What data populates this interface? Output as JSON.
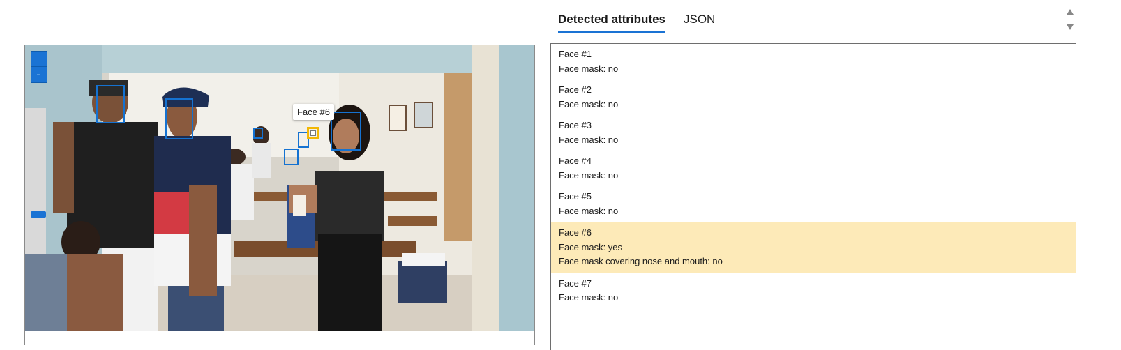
{
  "tabs": [
    {
      "label": "Detected attributes",
      "active": true
    },
    {
      "label": "JSON",
      "active": false
    }
  ],
  "tooltip": "Face #6",
  "faces": [
    {
      "title": "Face #1",
      "attributes": [
        "Face mask: no"
      ]
    },
    {
      "title": "Face #2",
      "attributes": [
        "Face mask: no"
      ]
    },
    {
      "title": "Face #3",
      "attributes": [
        "Face mask: no"
      ]
    },
    {
      "title": "Face #4",
      "attributes": [
        "Face mask: no"
      ]
    },
    {
      "title": "Face #5",
      "attributes": [
        "Face mask: no"
      ]
    },
    {
      "title": "Face #6",
      "attributes": [
        "Face mask: yes",
        "Face mask covering nose and mouth: no"
      ]
    },
    {
      "title": "Face #7",
      "attributes": [
        "Face mask: no"
      ]
    }
  ],
  "colors": {
    "accent": "#1a73d4",
    "face_box": "#1572d1",
    "selected_box": "#f2b705",
    "highlight_bg": "#fdeab8"
  },
  "icons": [
    "zoom-in-icon",
    "zoom-out-icon",
    "scroll-up-icon",
    "scroll-down-icon"
  ]
}
